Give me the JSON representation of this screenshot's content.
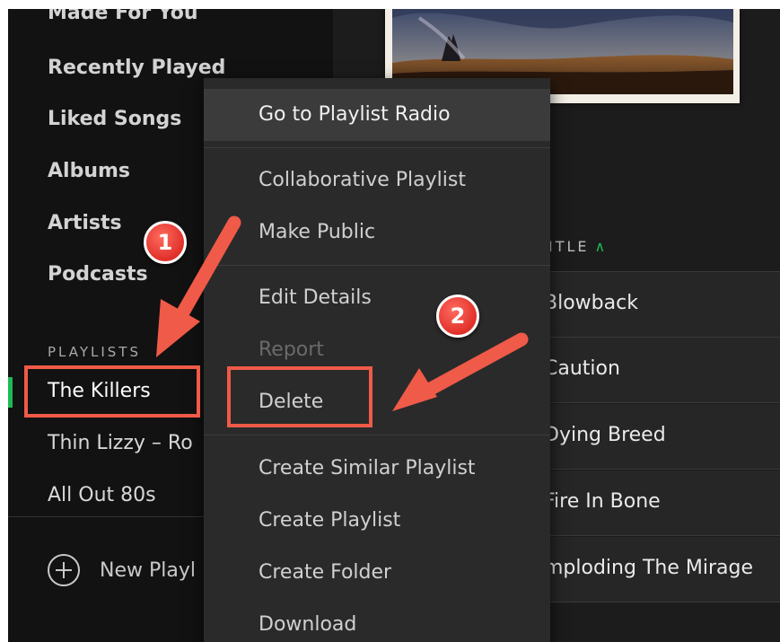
{
  "sidebar": {
    "nav": [
      {
        "label": "Made For You"
      },
      {
        "label": "Recently Played"
      },
      {
        "label": "Liked Songs"
      },
      {
        "label": "Albums"
      },
      {
        "label": "Artists"
      },
      {
        "label": "Podcasts"
      }
    ],
    "playlists_title": "PLAYLISTS",
    "playlists": [
      {
        "label": "The Killers",
        "active": true
      },
      {
        "label": "Thin Lizzy – Ro"
      },
      {
        "label": "All Out 80s"
      }
    ],
    "new_playlist_label": "New Playl"
  },
  "main": {
    "column_header": "ITLE",
    "tracks": [
      {
        "title": "Blowback"
      },
      {
        "title": "Caution"
      },
      {
        "title": "Dying Breed"
      },
      {
        "title": "Fire In Bone"
      },
      {
        "title": "mploding The Mirage"
      }
    ]
  },
  "context_menu": {
    "items": [
      {
        "label": "Go to Playlist Radio"
      },
      {
        "label": "Collaborative Playlist"
      },
      {
        "label": "Make Public"
      },
      {
        "label": "Edit Details"
      },
      {
        "label": "Report"
      },
      {
        "label": "Delete"
      },
      {
        "label": "Create Similar Playlist"
      },
      {
        "label": "Create Playlist"
      },
      {
        "label": "Create Folder"
      },
      {
        "label": "Download"
      }
    ]
  },
  "annotations": {
    "badge1": "1",
    "badge2": "2",
    "color": "#f05a48"
  },
  "colors": {
    "accent": "#1db954",
    "background": "#121212",
    "menu": "#2a2a2a"
  }
}
